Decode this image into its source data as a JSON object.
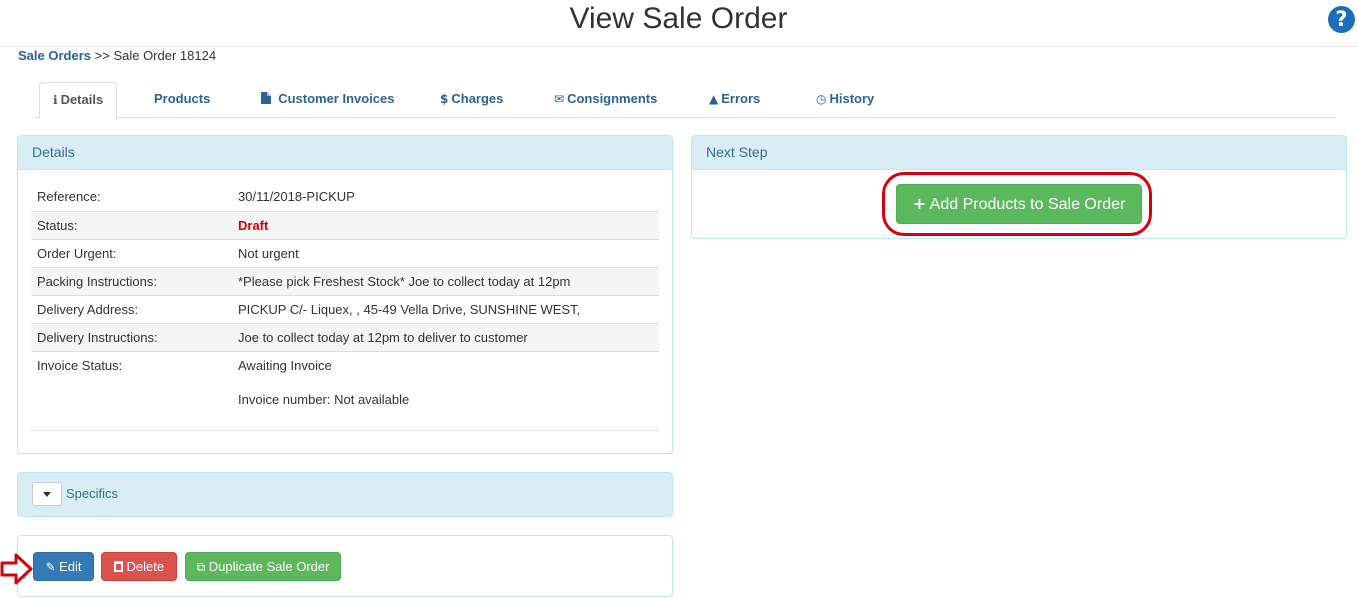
{
  "header": {
    "title": "View Sale Order",
    "help_icon": "question-circle-icon"
  },
  "breadcrumb": {
    "link": "Sale Orders",
    "separator": ">>",
    "current": "Sale Order 18124"
  },
  "tabs": [
    {
      "label": "Details",
      "icon": "info-icon",
      "glyph": "ℹ",
      "active": true
    },
    {
      "label": "Products",
      "icon": "",
      "glyph": "",
      "active": false
    },
    {
      "label": "Customer Invoices",
      "icon": "file-icon",
      "glyph": "▇",
      "active": false
    },
    {
      "label": "Charges",
      "icon": "dollar-icon",
      "glyph": "$",
      "active": false
    },
    {
      "label": "Consignments",
      "icon": "envelope-icon",
      "glyph": "✉",
      "active": false
    },
    {
      "label": "Errors",
      "icon": "warning-icon",
      "glyph": "▲",
      "active": false
    },
    {
      "label": "History",
      "icon": "clock-icon",
      "glyph": "◷",
      "active": false
    }
  ],
  "details": {
    "heading": "Details",
    "rows": [
      {
        "label": "Reference:",
        "value": "30/11/2018-PICKUP"
      },
      {
        "label": "Status:",
        "value": "Draft"
      },
      {
        "label": "Order Urgent:",
        "value": "Not urgent"
      },
      {
        "label": "Packing Instructions:",
        "value": "*Please pick Freshest Stock* Joe to collect today at 12pm"
      },
      {
        "label": "Delivery Address:",
        "value": "PICKUP C/- Liquex, , 45-49 Vella Drive, SUNSHINE WEST,"
      },
      {
        "label": "Delivery Instructions:",
        "value": "Joe to collect today at 12pm to deliver to customer"
      },
      {
        "label": "Invoice Status:",
        "value": "Awaiting Invoice",
        "extra": "Invoice number: Not available"
      }
    ]
  },
  "next_step": {
    "heading": "Next Step",
    "button_label": "Add Products to Sale Order",
    "button_icon": "plus-icon"
  },
  "specifics": {
    "label": "Specifics",
    "toggle_icon": "caret-down-icon"
  },
  "actions": {
    "edit_label": "Edit",
    "delete_label": "Delete",
    "duplicate_label": "Duplicate Sale Order"
  },
  "colors": {
    "link": "#2a6496",
    "panel_heading_bg": "#d9edf7",
    "draft_status": "#dd0000",
    "green_button": "#5cb85c",
    "blue_button": "#337ab7",
    "red_button": "#d9534f",
    "annotation_red": "#d7000f"
  }
}
